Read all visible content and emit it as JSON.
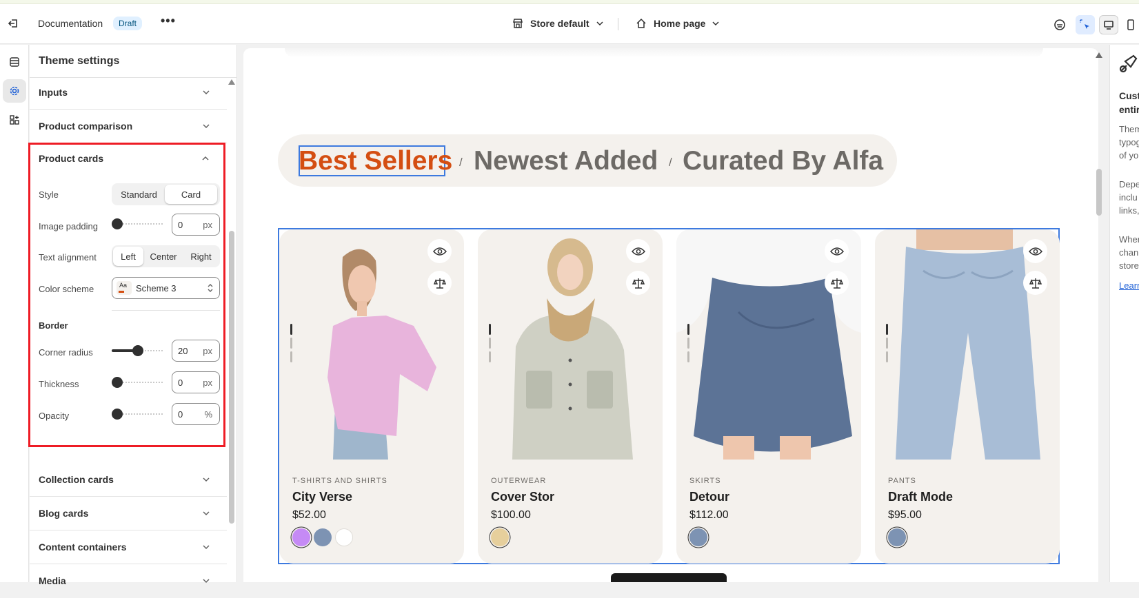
{
  "topbar": {
    "title": "Documentation",
    "badge": "Draft",
    "more": "•••",
    "store": "Store default",
    "page": "Home page",
    "icons": [
      "exit-icon",
      "store-icon",
      "home-icon",
      "ai-icon",
      "inspector-icon",
      "desktop-icon",
      "mobile-icon"
    ]
  },
  "sidebar": {
    "title": "Theme settings",
    "sections_above": [
      {
        "label": "Inputs"
      },
      {
        "label": "Product comparison"
      }
    ],
    "product_cards": {
      "label": "Product cards",
      "style": {
        "label": "Style",
        "options": [
          "Standard",
          "Card"
        ],
        "selected": "Card"
      },
      "image_padding": {
        "label": "Image padding",
        "value": "0",
        "unit": "px",
        "level": 0
      },
      "text_alignment": {
        "label": "Text alignment",
        "options": [
          "Left",
          "Center",
          "Right"
        ],
        "selected": "Left"
      },
      "color_scheme": {
        "label": "Color scheme",
        "preview": "Aa",
        "value": "Scheme 3"
      },
      "border": {
        "heading": "Border"
      },
      "corner_radius": {
        "label": "Corner radius",
        "value": "20",
        "unit": "px",
        "level": 0.5
      },
      "thickness": {
        "label": "Thickness",
        "value": "0",
        "unit": "px",
        "level": 0
      },
      "opacity": {
        "label": "Opacity",
        "value": "0",
        "unit": "%",
        "level": 0
      }
    },
    "sections_below": [
      {
        "label": "Collection cards"
      },
      {
        "label": "Blog cards"
      },
      {
        "label": "Content containers"
      },
      {
        "label": "Media"
      }
    ]
  },
  "preview": {
    "tabs": [
      "Best Sellers",
      "Newest Added",
      "Curated By Alfa"
    ],
    "separator": "/",
    "active_tab": "Best Sellers",
    "products": [
      {
        "category": "T-SHIRTS AND SHIRTS",
        "name": "City Verse",
        "price": "$52.00",
        "swatches": [
          "#c58af5",
          "#7d93b3",
          "#ffffff"
        ]
      },
      {
        "category": "OUTERWEAR",
        "name": "Cover Stor",
        "price": "$100.00",
        "swatches": [
          "#e6cf9c"
        ]
      },
      {
        "category": "SKIRTS",
        "name": "Detour",
        "price": "$112.00",
        "swatches": [
          "#7d93b3"
        ]
      },
      {
        "category": "PANTS",
        "name": "Draft Mode",
        "price": "$95.00",
        "swatches": [
          "#7d93b3"
        ]
      }
    ]
  },
  "right_panel": {
    "heading_lines": [
      "Cust",
      "entir"
    ],
    "para1": [
      "Them",
      "typog",
      "of yo"
    ],
    "para2": [
      "Depe",
      "inclu",
      "links,"
    ],
    "para3": [
      "Wher",
      "chan",
      "store"
    ],
    "link": "Learr"
  },
  "colors": {
    "accent_blue": "#3d7adf",
    "highlight_red": "#ee1c25",
    "active_tab": "#d44e12",
    "card_bg": "#f4f1ed"
  }
}
